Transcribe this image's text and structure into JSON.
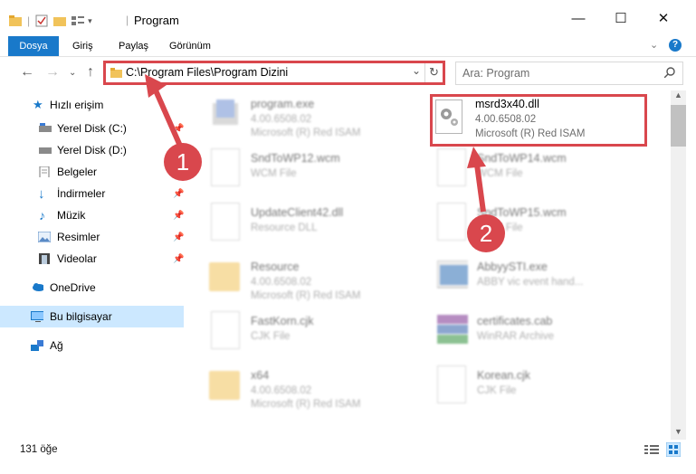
{
  "window": {
    "title": "Program",
    "minimize": "—",
    "maximize": "☐",
    "close": "✕"
  },
  "ribbon": {
    "tabs": [
      "Dosya",
      "Giriş",
      "Paylaş",
      "Görünüm"
    ],
    "help": "?"
  },
  "address": {
    "path": "C:\\Program Files\\Program Dizini",
    "search_placeholder": "Ara: Program"
  },
  "sidebar": {
    "items": [
      {
        "label": "Hızlı erişim",
        "icon": "star-icon"
      },
      {
        "label": "Yerel Disk (C:)",
        "icon": "drive-icon"
      },
      {
        "label": "Yerel Disk (D:)",
        "icon": "drive-icon"
      },
      {
        "label": "Belgeler",
        "icon": "documents-icon"
      },
      {
        "label": "İndirmeler",
        "icon": "download-icon"
      },
      {
        "label": "Müzik",
        "icon": "music-icon"
      },
      {
        "label": "Resimler",
        "icon": "pictures-icon"
      },
      {
        "label": "Videolar",
        "icon": "videos-icon"
      },
      {
        "label": "OneDrive",
        "icon": "cloud-icon"
      },
      {
        "label": "Bu bilgisayar",
        "icon": "computer-icon"
      },
      {
        "label": "Ağ",
        "icon": "network-icon"
      }
    ]
  },
  "files": {
    "left": [
      {
        "name": "program.exe",
        "line1": "4.00.6508.02",
        "line2": "Microsoft (R) Red ISAM",
        "kind": "exe"
      },
      {
        "name": "SndToWP12.wcm",
        "line1": "WCM File",
        "line2": "",
        "kind": "file"
      },
      {
        "name": "UpdateClient42.dll",
        "line1": "Resource DLL",
        "line2": "",
        "kind": "dll"
      },
      {
        "name": "Resource",
        "line1": "4.00.6508.02",
        "line2": "Microsoft (R) Red ISAM",
        "kind": "folder"
      },
      {
        "name": "FastKorn.cjk",
        "line1": "CJK File",
        "line2": "",
        "kind": "file"
      },
      {
        "name": "x64",
        "line1": "4.00.6508.02",
        "line2": "Microsoft (R) Red ISAM",
        "kind": "folder"
      }
    ],
    "right": [
      {
        "name": "msrd3x40.dll",
        "line1": "4.00.6508.02",
        "line2": "Microsoft (R) Red ISAM",
        "kind": "dll"
      },
      {
        "name": "SndToWP14.wcm",
        "line1": "WCM File",
        "line2": "",
        "kind": "file"
      },
      {
        "name": "SndToWP15.wcm",
        "line1": "WCM File",
        "line2": "",
        "kind": "file"
      },
      {
        "name": "AbbyySTI.exe",
        "line1": "ABBY vic event hand...",
        "line2": "",
        "kind": "app"
      },
      {
        "name": "certificates.cab",
        "line1": "WinRAR Archive",
        "line2": "",
        "kind": "archive"
      },
      {
        "name": "Korean.cjk",
        "line1": "CJK File",
        "line2": "",
        "kind": "file"
      }
    ]
  },
  "status": {
    "count": "131 öğe"
  },
  "callouts": [
    "1",
    "2"
  ],
  "colors": {
    "accent": "#1979ca",
    "highlight": "#d9474d",
    "selected_nav": "#cce8ff"
  }
}
